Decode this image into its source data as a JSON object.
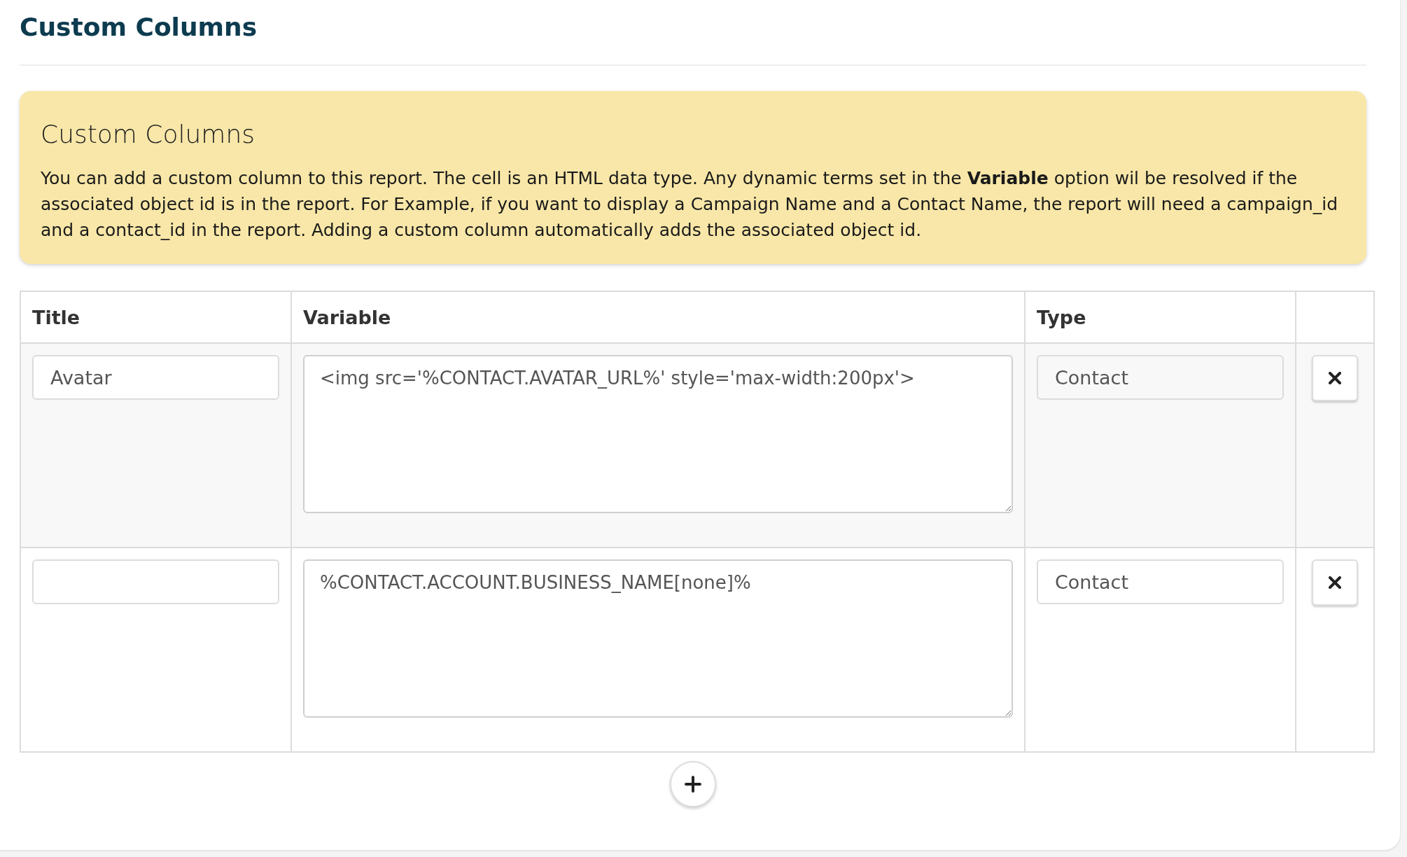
{
  "page_title": "Custom Columns",
  "notice": {
    "heading": "Custom Columns",
    "body": "You can add a custom column to this report. The cell is an HTML data type. Any dynamic terms set in the **Variable** option wil be resolved if the associated object id is in the report. For Example, if you want to display a Campaign Name and a Contact Name, the report will need a campaign_id and a contact_id in the report. Adding a custom column automatically adds the associated object id."
  },
  "table": {
    "columns": [
      "Title",
      "Variable",
      "Type"
    ],
    "rows": [
      {
        "title": "Avatar",
        "variable": "<img src='%CONTACT.AVATAR_URL%' style='max-width:200px'>",
        "type": "Contact"
      },
      {
        "variable": "%CONTACT.ACCOUNT.BUSINESS_NAME[none]%",
        "type": "Contact"
      }
    ]
  }
}
